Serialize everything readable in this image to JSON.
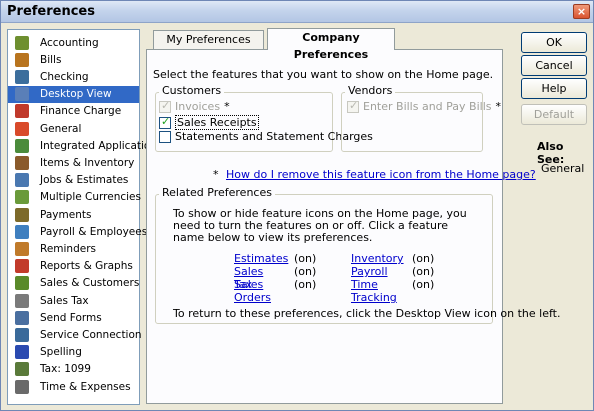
{
  "window": {
    "title": "Preferences",
    "close_label": "×"
  },
  "sidebar": {
    "items": [
      {
        "label": "Accounting",
        "icon": "accounting-icon",
        "color": "#6e8f2f"
      },
      {
        "label": "Bills",
        "icon": "bills-icon",
        "color": "#b8741e"
      },
      {
        "label": "Checking",
        "icon": "checking-icon",
        "color": "#3c6e9c"
      },
      {
        "label": "Desktop View",
        "icon": "desktop-view-icon",
        "color": "#5a7fb8"
      },
      {
        "label": "Finance Charge",
        "icon": "finance-charge-icon",
        "color": "#c0392b"
      },
      {
        "label": "General",
        "icon": "general-icon",
        "color": "#d94a2a"
      },
      {
        "label": "Integrated Applications",
        "icon": "integrated-apps-icon",
        "color": "#4b8b3b"
      },
      {
        "label": "Items & Inventory",
        "icon": "items-inventory-icon",
        "color": "#8a5a2b"
      },
      {
        "label": "Jobs & Estimates",
        "icon": "jobs-estimates-icon",
        "color": "#4a78b0"
      },
      {
        "label": "Multiple Currencies",
        "icon": "multiple-currencies-icon",
        "color": "#6a9a3a"
      },
      {
        "label": "Payments",
        "icon": "payments-icon",
        "color": "#7d6a2a"
      },
      {
        "label": "Payroll & Employees",
        "icon": "payroll-employees-icon",
        "color": "#3f7fbf"
      },
      {
        "label": "Reminders",
        "icon": "reminders-icon",
        "color": "#c07a2a"
      },
      {
        "label": "Reports & Graphs",
        "icon": "reports-graphs-icon",
        "color": "#c23b2b"
      },
      {
        "label": "Sales & Customers",
        "icon": "sales-customers-icon",
        "color": "#5a8a2a"
      },
      {
        "label": "Sales Tax",
        "icon": "sales-tax-icon",
        "color": "#7a7a7a"
      },
      {
        "label": "Send Forms",
        "icon": "send-forms-icon",
        "color": "#4a6fa0"
      },
      {
        "label": "Service Connection",
        "icon": "service-connection-icon",
        "color": "#3a6a9a"
      },
      {
        "label": "Spelling",
        "icon": "spelling-icon",
        "color": "#2a4ab0"
      },
      {
        "label": "Tax: 1099",
        "icon": "tax-1099-icon",
        "color": "#5a7a3a"
      },
      {
        "label": "Time & Expenses",
        "icon": "time-expenses-icon",
        "color": "#6a6a6a"
      }
    ],
    "selected": "Desktop View"
  },
  "tabs": [
    {
      "label": "My Preferences",
      "active": false
    },
    {
      "label": "Company Preferences",
      "active": true
    }
  ],
  "panel": {
    "intro": "Select the features that you want to show on the Home page.",
    "customers": {
      "label": "Customers",
      "invoices": {
        "label": "Invoices",
        "marker": "*",
        "checked": true,
        "disabled": true
      },
      "sales_receipts": {
        "label": "Sales Receipts",
        "checked": true,
        "disabled": false
      },
      "statements": {
        "label": "Statements and Statement Charges",
        "checked": false,
        "disabled": false
      }
    },
    "vendors": {
      "label": "Vendors",
      "enter_bills": {
        "label": "Enter Bills and Pay Bills",
        "marker": "*",
        "checked": true,
        "disabled": true
      }
    },
    "help_marker": "*",
    "help_link": "How do I remove this feature icon from the Home page?",
    "related": {
      "label": "Related Preferences",
      "text": "To show or hide feature icons on the Home page, you need to turn the features on or off. Click a feature name below to view its preferences.",
      "prefs": [
        {
          "name": "Estimates",
          "status": "(on)"
        },
        {
          "name": "Inventory",
          "status": "(on)"
        },
        {
          "name": "Sales Tax",
          "status": "(on)"
        },
        {
          "name": "Payroll",
          "status": "(on)"
        },
        {
          "name": "Sales Orders",
          "status": "(on)"
        },
        {
          "name": "Time Tracking",
          "status": "(on)"
        }
      ],
      "footer": "To return to these preferences, click the Desktop View icon on the left."
    }
  },
  "buttons": {
    "ok": "OK",
    "cancel": "Cancel",
    "help": "Help",
    "default": "Default"
  },
  "also_see": {
    "label": "Also See:",
    "items": [
      "General"
    ]
  }
}
